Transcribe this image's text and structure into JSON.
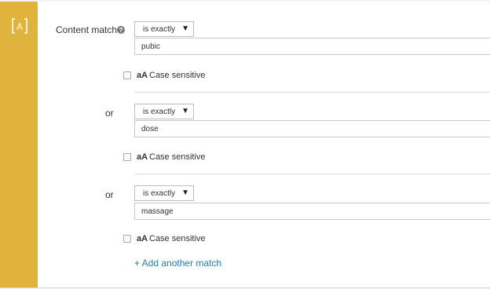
{
  "rail": {
    "icon": "bracket-a-icon",
    "accent_color": "#e0b43c"
  },
  "field": {
    "label": "Content match",
    "help_icon": "question-circle-icon"
  },
  "matches": [
    {
      "connector": "",
      "operator": "is exactly",
      "value": "pubic",
      "case_label": "Case sensitive",
      "case_icon": "aA"
    },
    {
      "connector": "or",
      "operator": "is exactly",
      "value": "dose",
      "case_label": "Case sensitive",
      "case_icon": "aA"
    },
    {
      "connector": "or",
      "operator": "is exactly",
      "value": "massage",
      "case_label": "Case sensitive",
      "case_icon": "aA"
    }
  ],
  "add_link": "+ Add another match",
  "link_color": "#2a7bb5"
}
